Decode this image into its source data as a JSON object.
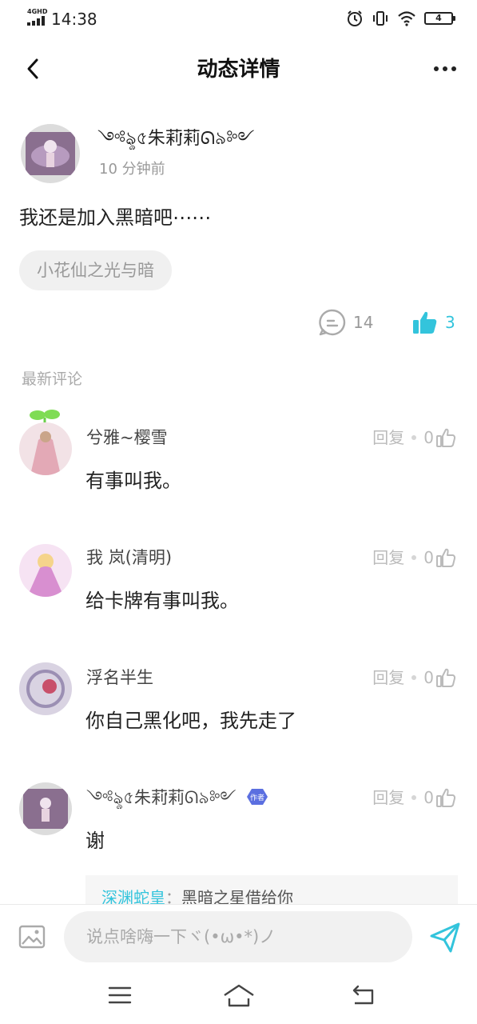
{
  "status_bar": {
    "network": "4GHD",
    "time": "14:38",
    "battery": "4"
  },
  "header": {
    "title": "动态详情"
  },
  "post": {
    "author": "༺ৡ৫朱莉ᡃ莉ᘏ৯༻",
    "time": "10 分钟前",
    "text": "我还是加入黑暗吧⋯⋯",
    "tag": "小花仙之光与暗",
    "comment_count": "14",
    "like_count": "3"
  },
  "section_label": "最新评论",
  "comments": [
    {
      "name": "兮雅~樱雪",
      "text": "有事叫我。",
      "reply": "回复",
      "likes": "0"
    },
    {
      "name": "我 岚(清明)",
      "text": "给卡牌有事叫我。",
      "reply": "回复",
      "likes": "0"
    },
    {
      "name": "浮名半生",
      "text": "你自己黑化吧，我先走了",
      "reply": "回复",
      "likes": "0"
    },
    {
      "name": "༺ৡ৫朱莉ᡃ莉ᘏ৯༻",
      "text": "谢",
      "reply": "回复",
      "likes": "0",
      "author_badge": "作者",
      "sub_reply": {
        "user": "深渊蛇皇",
        "separator": "：",
        "text": "黑暗之星借给你"
      }
    }
  ],
  "input": {
    "placeholder": "说点啥嗨一下ヾ(•ω•*)ノ"
  },
  "colors": {
    "accent": "#33c4dc",
    "muted": "#999999",
    "badge": "#5b6fe0"
  }
}
